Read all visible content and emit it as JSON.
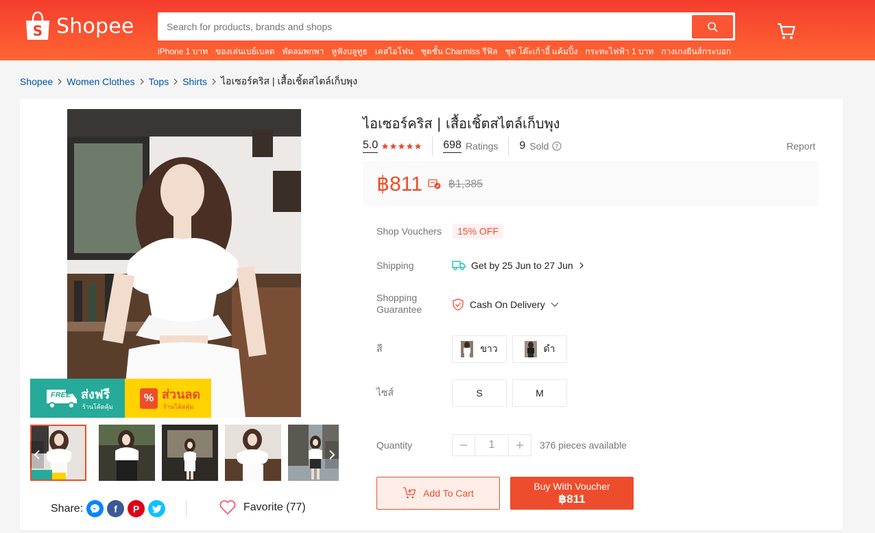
{
  "header": {
    "logo_text": "Shopee",
    "search_placeholder": "Search for products, brands and shops",
    "hot_words": [
      "iPhone 1 บาท",
      "ของเล่นเบย์เบลด",
      "พัดลมพกพา",
      "หูฟังบลูทูธ",
      "เคสไอโฟน",
      "ชุดชั้น Charmiss รีฟิล",
      "ชุด โต๊ะเก้าอี้ แค้มปิ้ง",
      "กระทะไฟฟ้า 1 บาท",
      "กางเกงยีนส์กระบอก"
    ]
  },
  "breadcrumb": {
    "items": [
      "Shopee",
      "Women Clothes",
      "Tops",
      "Shirts"
    ],
    "current": "ไอเซอร์คริส | เสื้อเชิ้ตสไตล์เก็บพุง"
  },
  "gallery": {
    "promo_free_badge": "FREE",
    "promo_free": "ส่งฟรี",
    "promo_free_sub": "ร้านโค้ดคุ้ม",
    "promo_discount_badge": "%",
    "promo_discount": "ส่วนลด",
    "promo_discount_sub": "ร้านโค้ดคุ้ม"
  },
  "share": {
    "label": "Share:",
    "favorite_label": "Favorite (77)"
  },
  "product": {
    "title": "ไอเซอร์คริส | เสื้อเชิ้ตสไตล์เก็บพุง",
    "rating": "5.0",
    "ratings_count": "698",
    "ratings_label": "Ratings",
    "sold_count": "9",
    "sold_label": "Sold",
    "report_label": "Report",
    "price": "฿811",
    "original_price": "฿1,385",
    "vouchers_label": "Shop Vouchers",
    "voucher": "15% OFF",
    "shipping_label": "Shipping",
    "shipping_value": "Get by 25 Jun to 27 Jun",
    "guarantee_label_1": "Shopping",
    "guarantee_label_2": "Guarantee",
    "guarantee_value": "Cash On Delivery",
    "color_label": "สี",
    "colors": [
      "ขาว",
      "ดำ"
    ],
    "size_label": "ไซส์",
    "sizes": [
      "S",
      "M"
    ],
    "quantity_label": "Quantity",
    "quantity": "1",
    "available": "376 pieces available",
    "add_to_cart": "Add To Cart",
    "buy_line1": "Buy With Voucher",
    "buy_line2": "฿811"
  },
  "colors": {
    "brand": "#ee4d2d",
    "header": "#f53d2d",
    "link": "#0055aa",
    "promo_green": "#26aa99",
    "promo_yellow": "#ffd200"
  },
  "icons": [
    "search-icon",
    "cart-icon",
    "chevron-right-icon",
    "star-icon",
    "help-icon",
    "truck-icon",
    "shield-icon",
    "chevron-down-icon",
    "minus-icon",
    "plus-icon",
    "add-cart-icon",
    "messenger-icon",
    "facebook-icon",
    "pinterest-icon",
    "twitter-icon",
    "heart-icon"
  ]
}
